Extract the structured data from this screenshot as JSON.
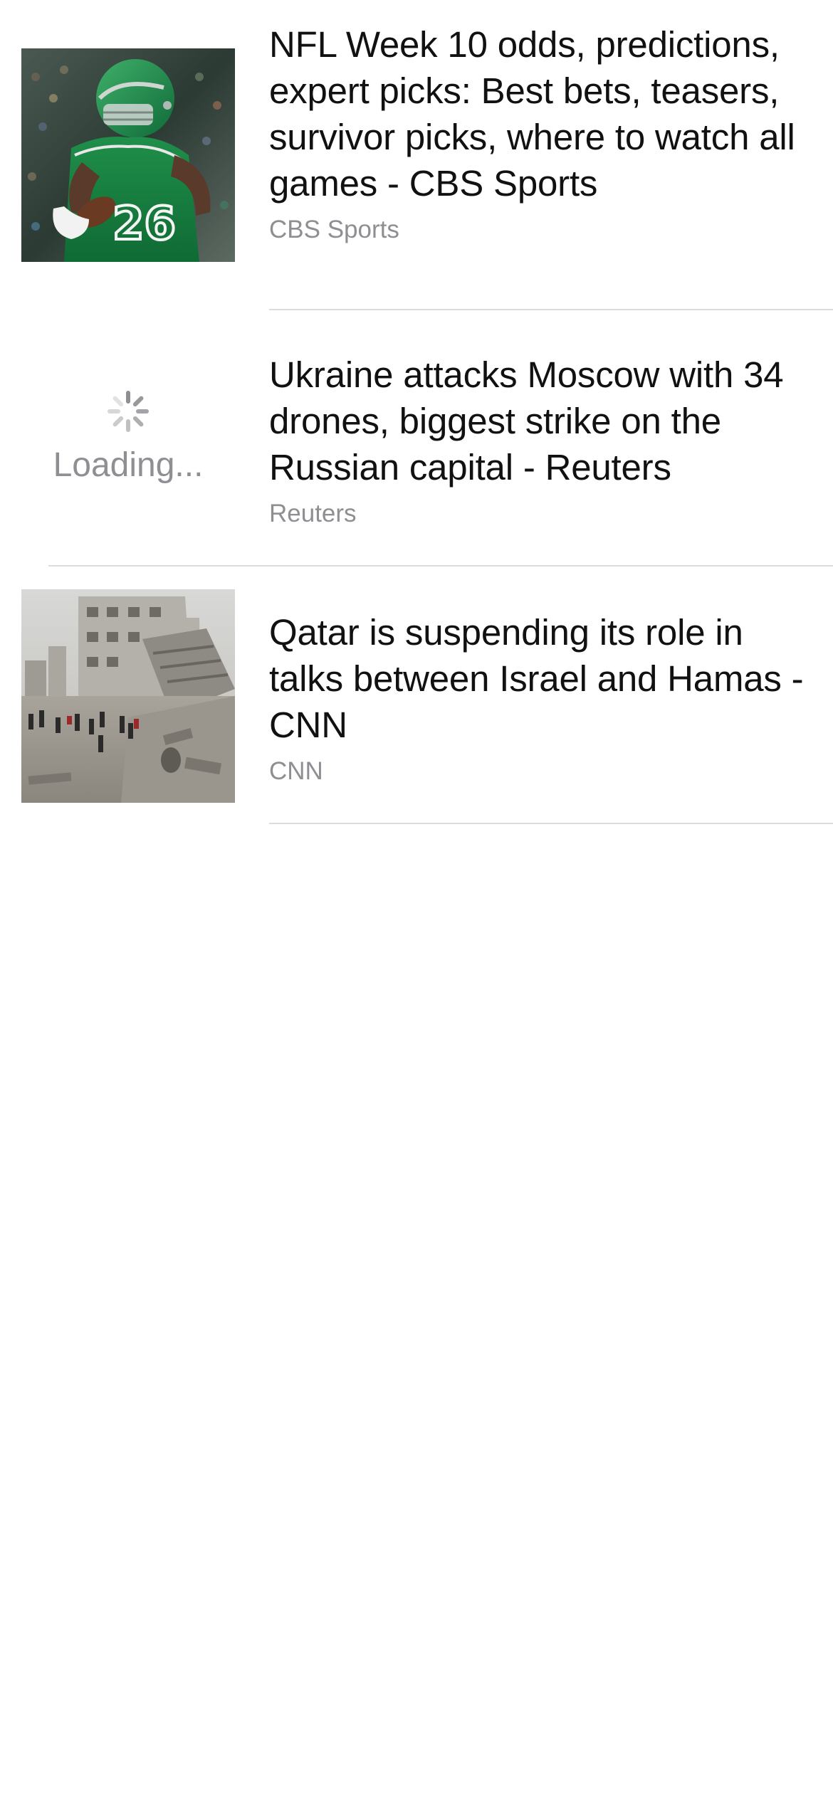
{
  "articles": [
    {
      "headline": "NFL Week 10 odds, predictions, expert picks: Best bets, teasers, survivor picks, where to watch all games - CBS Sports",
      "source": "CBS Sports",
      "thumbnail": "football-player-photo"
    },
    {
      "headline": "Ukraine attacks Moscow with 34 drones, biggest strike on the Russian capital - Reuters",
      "source": "Reuters",
      "thumbnail_state": "Loading..."
    },
    {
      "headline": "Qatar is suspending its role in talks between Israel and Hamas - CNN",
      "source": "CNN",
      "thumbnail": "destroyed-buildings-photo"
    }
  ],
  "colors": {
    "headline": "#111111",
    "source": "#8e8e93",
    "divider": "#dcdcdc",
    "background": "#ffffff"
  }
}
